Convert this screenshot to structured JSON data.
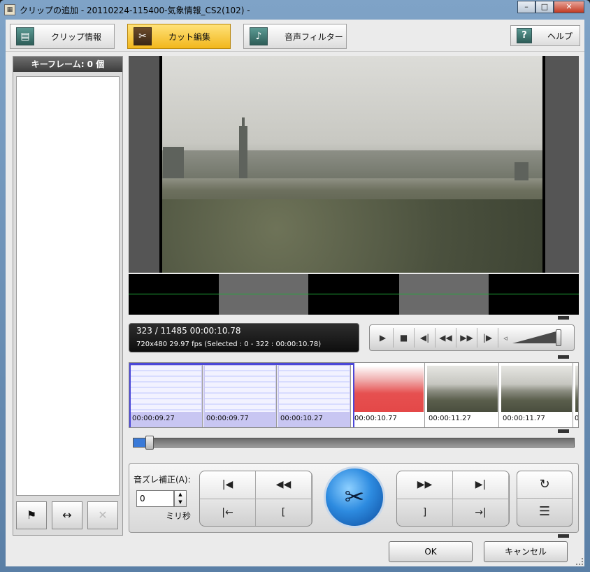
{
  "window": {
    "title": "クリップの追加 - 20110224-115400-気象情報_CS2(102) -",
    "minimize": "–",
    "maximize": "□",
    "close": "✕"
  },
  "tabs": [
    {
      "label": "クリップ情報",
      "icon": "document-icon",
      "active": false
    },
    {
      "label": "カット編集",
      "icon": "scissors-icon",
      "active": true
    },
    {
      "label": "音声フィルター",
      "icon": "music-note-icon",
      "active": false
    }
  ],
  "help": {
    "label": "ヘルプ",
    "icon": "question-icon"
  },
  "keyframes": {
    "header": "キーフレーム: 0 個",
    "tools": [
      {
        "name": "flag-icon",
        "glyph": "⚑",
        "enabled": true
      },
      {
        "name": "split-arrows-icon",
        "glyph": "↔",
        "enabled": true
      },
      {
        "name": "delete-icon",
        "glyph": "✕",
        "enabled": false
      }
    ]
  },
  "status": {
    "line1": "323 / 11485 00:00:10.78",
    "line2": "720x480 29.97 fps (Selected : 0 - 322 : 00:00:10.78)"
  },
  "transport": {
    "buttons": [
      {
        "name": "play-icon",
        "glyph": "▶"
      },
      {
        "name": "stop-icon",
        "glyph": "■"
      },
      {
        "name": "step-back-icon",
        "glyph": "◀|"
      },
      {
        "name": "rewind-icon",
        "glyph": "◀◀"
      },
      {
        "name": "fast-forward-icon",
        "glyph": "▶▶"
      },
      {
        "name": "step-forward-icon",
        "glyph": "|▶"
      }
    ],
    "volume_icon": "speaker-icon",
    "volume_level": 1.0
  },
  "filmstrip": [
    {
      "timecode": "00:00:09.27",
      "selected": true,
      "kind": "slide"
    },
    {
      "timecode": "00:00:09.77",
      "selected": true,
      "kind": "slide"
    },
    {
      "timecode": "00:00:10.27",
      "selected": true,
      "kind": "slide"
    },
    {
      "timecode": "00:00:10.77",
      "selected": false,
      "kind": "red"
    },
    {
      "timecode": "00:00:11.27",
      "selected": false,
      "kind": "city"
    },
    {
      "timecode": "00:00:11.77",
      "selected": false,
      "kind": "city"
    },
    {
      "timecode": "0",
      "selected": false,
      "kind": "city"
    }
  ],
  "seek": {
    "position_frame": 323,
    "total_frames": 11485
  },
  "edit": {
    "sync_label": "音ズレ補正(A):",
    "sync_value": "0",
    "unit": "ミリ秒",
    "left_grid": [
      {
        "name": "go-to-start-icon",
        "glyph": "|◀"
      },
      {
        "name": "previous-keyframe-icon",
        "glyph": "◀◀"
      },
      {
        "name": "set-start-icon",
        "glyph": "|←"
      },
      {
        "name": "select-start-icon",
        "glyph": "["
      }
    ],
    "cut": {
      "name": "cut-scissors-icon",
      "glyph": "✂"
    },
    "right_grid": [
      {
        "name": "next-keyframe-icon",
        "glyph": "▶▶"
      },
      {
        "name": "go-to-end-icon",
        "glyph": "▶|"
      },
      {
        "name": "select-end-icon",
        "glyph": "]"
      },
      {
        "name": "set-end-icon",
        "glyph": "→|"
      }
    ],
    "side": [
      {
        "name": "undo-icon",
        "glyph": "↻"
      },
      {
        "name": "edit-list-icon",
        "glyph": "☰"
      }
    ]
  },
  "footer": {
    "ok": "OK",
    "cancel": "キャンセル"
  }
}
